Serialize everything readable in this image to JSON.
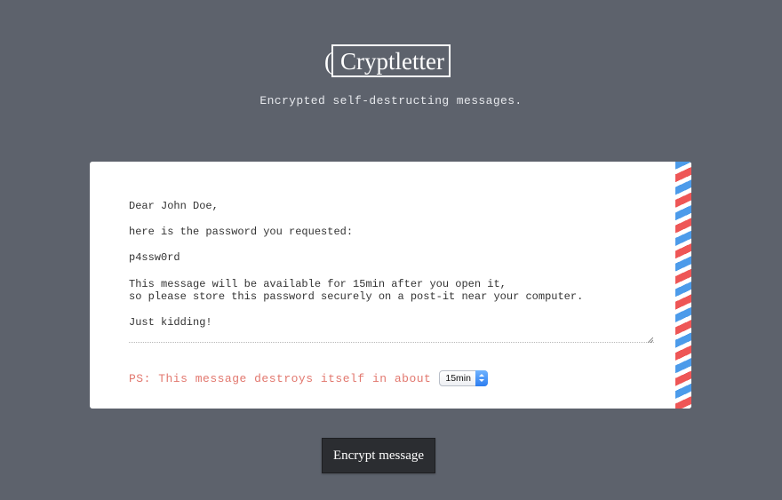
{
  "header": {
    "logo_text": "Cryptletter",
    "logo_icon": "key-icon",
    "subtitle": "Encrypted self-destructing messages."
  },
  "letter": {
    "message_value": "Dear John Doe,\n\nhere is the password you requested:\n\np4ssw0rd\n\nThis message will be available for 15min after you open it,\nso please store this password securely on a post-it near your computer.\n\nJust kidding!",
    "ps_text": "PS: This message destroys itself in about",
    "ttl_selected": "15min",
    "stripe_colors": [
      "#4c9bea",
      "#ffffff",
      "#ee5656"
    ]
  },
  "actions": {
    "encrypt_label": "Encrypt message"
  },
  "colors": {
    "background": "#5d626c",
    "card": "#ffffff",
    "ps_text": "#e2786f",
    "button": "#2b2d31"
  }
}
